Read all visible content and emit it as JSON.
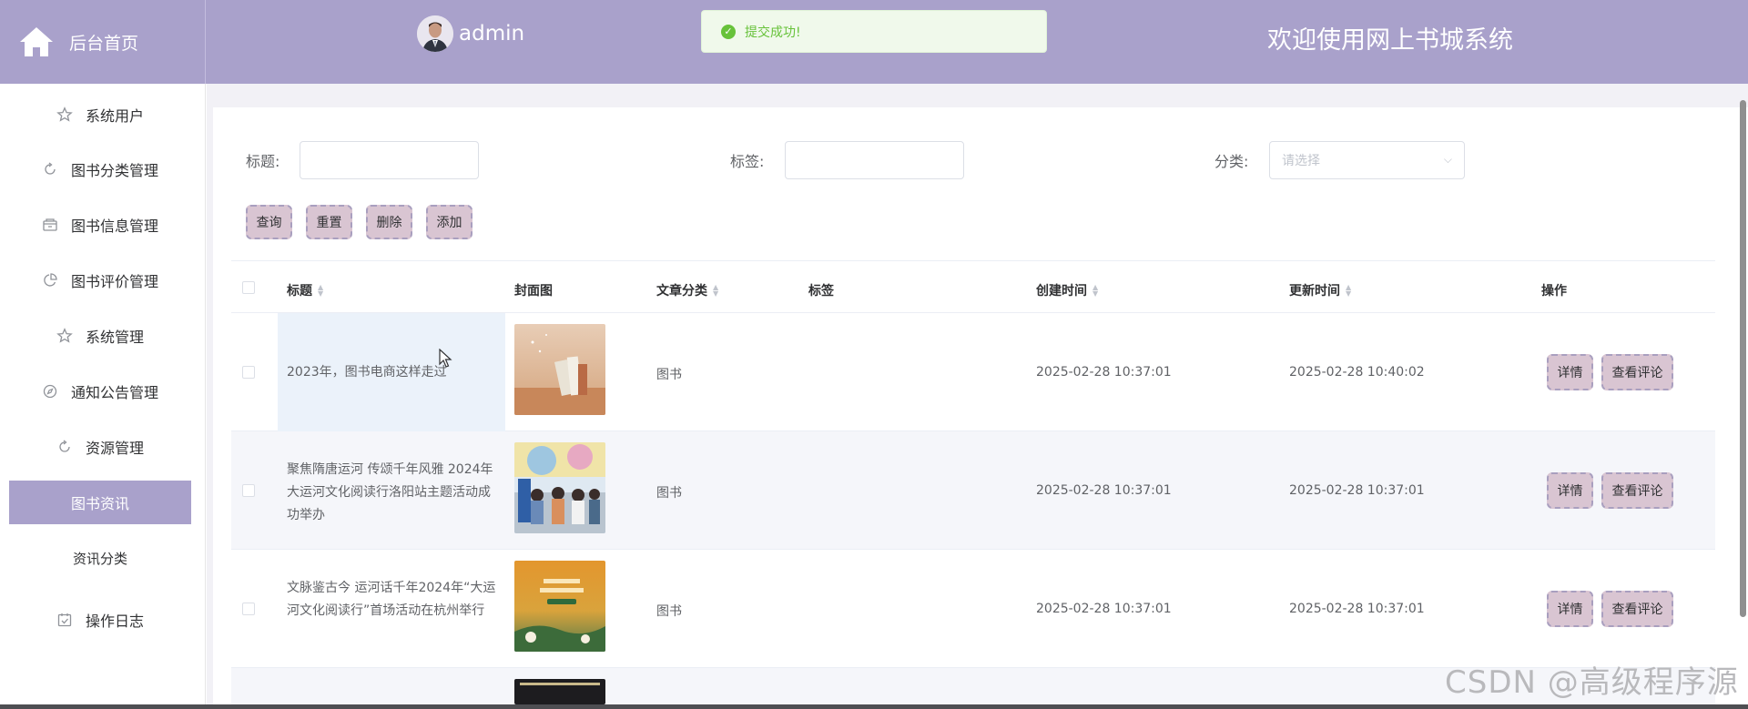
{
  "header": {
    "home_label": "后台首页",
    "username": "admin",
    "toast_text": "提交成功!",
    "site_title": "欢迎使用网上书城系统"
  },
  "sidebar": {
    "items": [
      {
        "label": "系统用户",
        "icon": "star-icon"
      },
      {
        "label": "图书分类管理",
        "icon": "refresh-icon"
      },
      {
        "label": "图书信息管理",
        "icon": "box-icon"
      },
      {
        "label": "图书评价管理",
        "icon": "pie-icon"
      },
      {
        "label": "系统管理",
        "icon": "star-icon"
      },
      {
        "label": "通知公告管理",
        "icon": "compass-icon"
      },
      {
        "label": "资源管理",
        "icon": "refresh-icon"
      },
      {
        "label": "图书资讯",
        "icon": "",
        "active": true
      },
      {
        "label": "资讯分类",
        "icon": ""
      },
      {
        "label": "操作日志",
        "icon": "calendar-check-icon"
      }
    ]
  },
  "filters": {
    "title_label": "标题:",
    "tag_label": "标签:",
    "category_label": "分类:",
    "category_placeholder": "请选择"
  },
  "actions": {
    "search": "查询",
    "reset": "重置",
    "delete": "删除",
    "add": "添加"
  },
  "table": {
    "columns": {
      "title": "标题",
      "cover": "封面图",
      "category": "文章分类",
      "tag": "标签",
      "created": "创建时间",
      "updated": "更新时间",
      "ops": "操作"
    },
    "detail_label": "详情",
    "comment_label": "查看评论",
    "rows": [
      {
        "title": "2023年，图书电商这样走过",
        "category": "图书",
        "tag": "",
        "created": "2025-02-28 10:37:01",
        "updated": "2025-02-28 10:40:02"
      },
      {
        "title": "聚焦隋唐运河 传颂千年风雅 2024年大运河文化阅读行洛阳站主题活动成功举办",
        "category": "图书",
        "tag": "",
        "created": "2025-02-28 10:37:01",
        "updated": "2025-02-28 10:37:01"
      },
      {
        "title": "文脉鉴古今 运河话千年2024年“大运河文化阅读行”首场活动在杭州举行",
        "category": "图书",
        "tag": "",
        "created": "2025-02-28 10:37:01",
        "updated": "2025-02-28 10:37:01"
      }
    ]
  },
  "watermark": "CSDN @高级程序源",
  "colors": {
    "header": "#a9a1cb",
    "active_menu": "#a9a1cb",
    "button_fill": "#d9c5d2",
    "button_border": "#a99fbf",
    "success": "#67c23a"
  }
}
